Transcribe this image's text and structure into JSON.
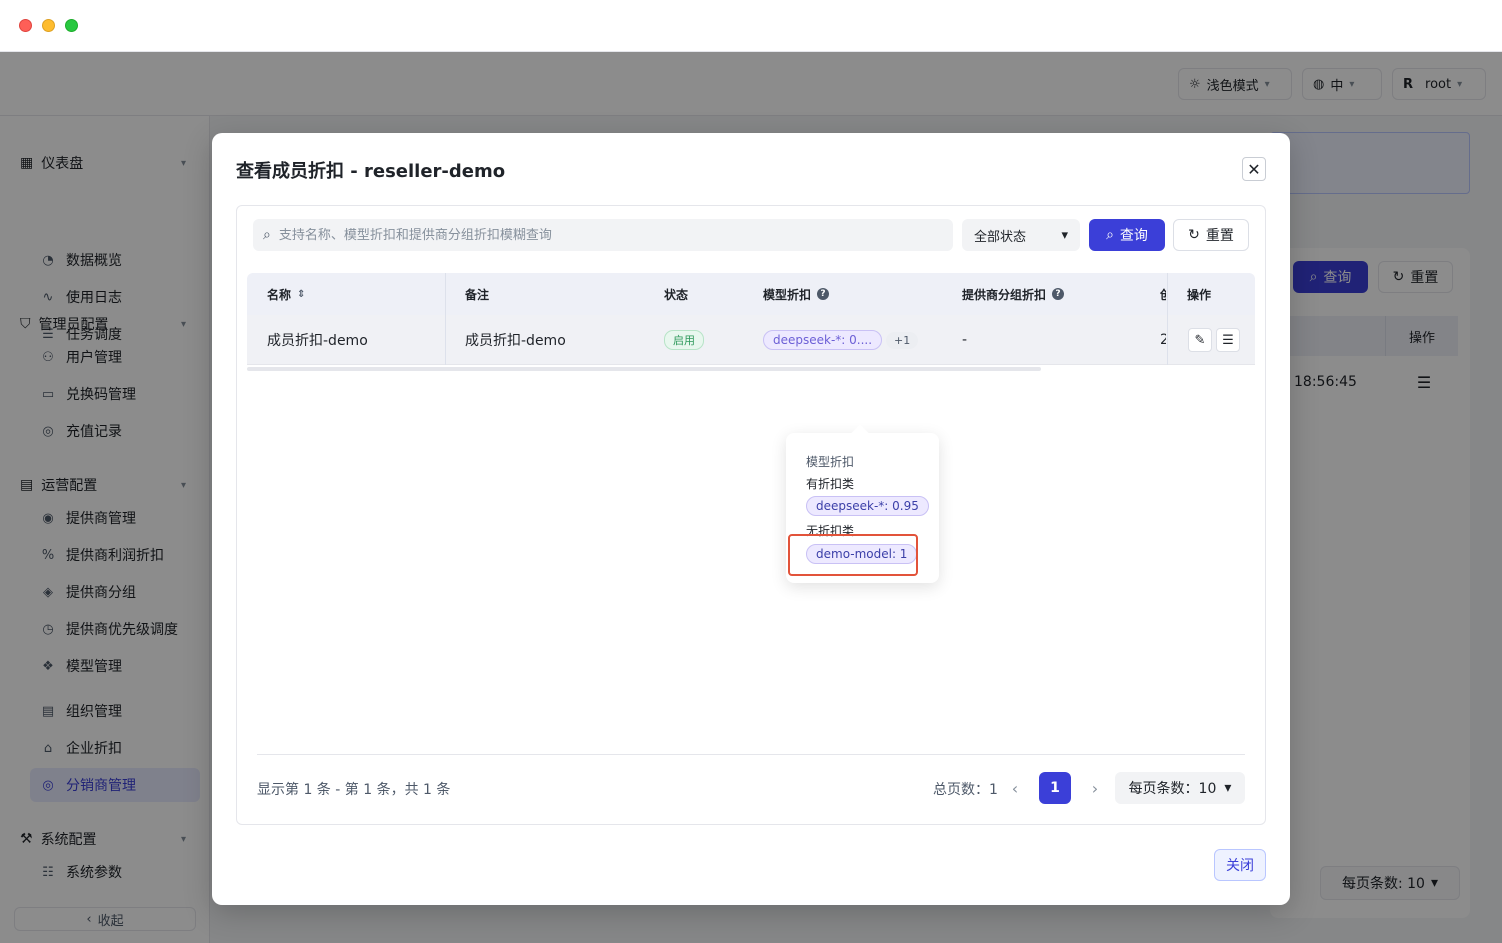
{
  "topbar": {
    "theme_label": "浅色模式",
    "lang_label": "中",
    "user_initial": "R",
    "user_name": "root"
  },
  "sidebar": {
    "groups": [
      {
        "label": "仪表盘",
        "items": [
          "数据概览",
          "使用日志",
          "任务调度"
        ]
      },
      {
        "label": "管理员配置",
        "items": [
          "用户管理",
          "兑换码管理",
          "充值记录"
        ]
      },
      {
        "label": "运营配置",
        "items": [
          "提供商管理",
          "提供商利润折扣",
          "提供商分组",
          "提供商优先级调度",
          "模型管理",
          "组织管理",
          "企业折扣",
          "分销商管理"
        ]
      },
      {
        "label": "系统配置",
        "items": [
          "系统参数"
        ]
      }
    ],
    "active_item": "分销商管理",
    "collapse_label": "收起"
  },
  "background": {
    "query_label": "查询",
    "reset_label": "重置",
    "op_header": "操作",
    "time_value": "18:56:45",
    "page_size_label": "每页条数: 10"
  },
  "modal": {
    "title": "查看成员折扣 - reseller-demo",
    "search_placeholder": "支持名称、模型折扣和提供商分组折扣模糊查询",
    "status_filter": "全部状态",
    "query_label": "查询",
    "reset_label": "重置",
    "columns": {
      "name": "名称",
      "remark": "备注",
      "status": "状态",
      "model_discount": "模型折扣",
      "provider_group_discount": "提供商分组折扣",
      "created_cut": "创",
      "actions": "操作"
    },
    "row": {
      "name": "成员折扣-demo",
      "remark": "成员折扣-demo",
      "status": "启用",
      "model_discount_tag": "deepseek-*: 0....",
      "model_discount_more": "+1",
      "provider_group_discount": "-",
      "created_cut": "2"
    },
    "popover": {
      "heading": "模型折扣",
      "discounted_label": "有折扣类",
      "discounted_tag": "deepseek-*: 0.95",
      "undiscounted_label": "无折扣类",
      "undiscounted_tag": "demo-model: 1"
    },
    "footer": {
      "range_text": "显示第 1 条 - 第 1 条，共 1 条",
      "total_pages": "总页数：1",
      "current_page": "1",
      "page_size": "每页条数：10"
    },
    "close_label": "关闭"
  }
}
